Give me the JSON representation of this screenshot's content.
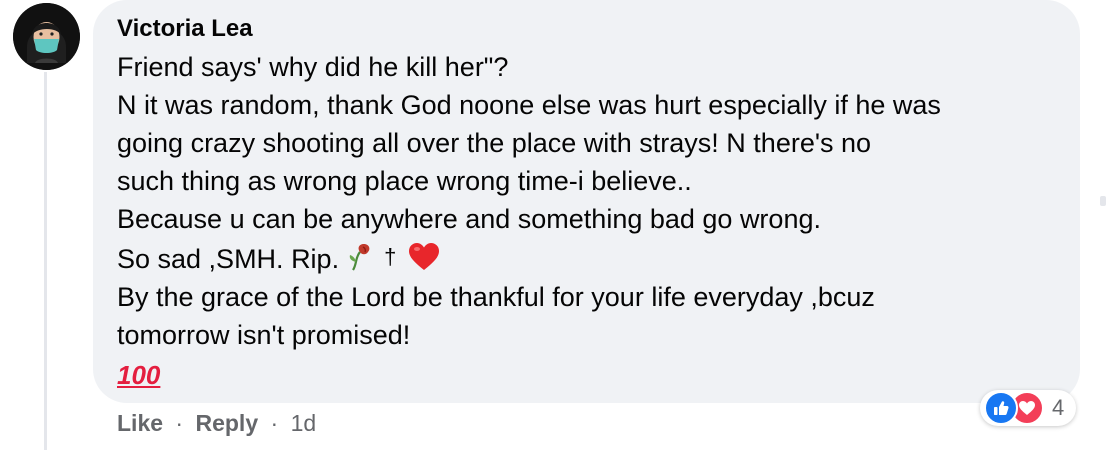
{
  "comment": {
    "author": "Victoria Lea",
    "lines": [
      "Friend says' why did he kill her\"?",
      "N it was random, thank God noone else was hurt especially if he was",
      "going crazy shooting all over the place with strays! N there's no",
      "such thing as wrong place wrong time-i believe..",
      "Because u can be anywhere and something bad go wrong.",
      "So sad ,SMH. Rip.",
      "By the grace of the Lord be thankful for your life everyday ,bcuz",
      "tomorrow isn't promised!"
    ],
    "cross_symbol": "†",
    "hundred_label": "100",
    "icons": [
      "wilted-rose-icon",
      "heart-icon",
      "hundred-points-icon"
    ]
  },
  "actions": {
    "like_label": "Like",
    "reply_label": "Reply",
    "separator": "·",
    "time": "1d"
  },
  "reactions": {
    "count": "4",
    "types": [
      "like",
      "love"
    ],
    "colors": {
      "like": "#1877f2",
      "love": "#f33e58"
    }
  },
  "colors": {
    "bubble": "#f0f2f5",
    "text": "#050505",
    "secondary_text": "#65676b"
  }
}
